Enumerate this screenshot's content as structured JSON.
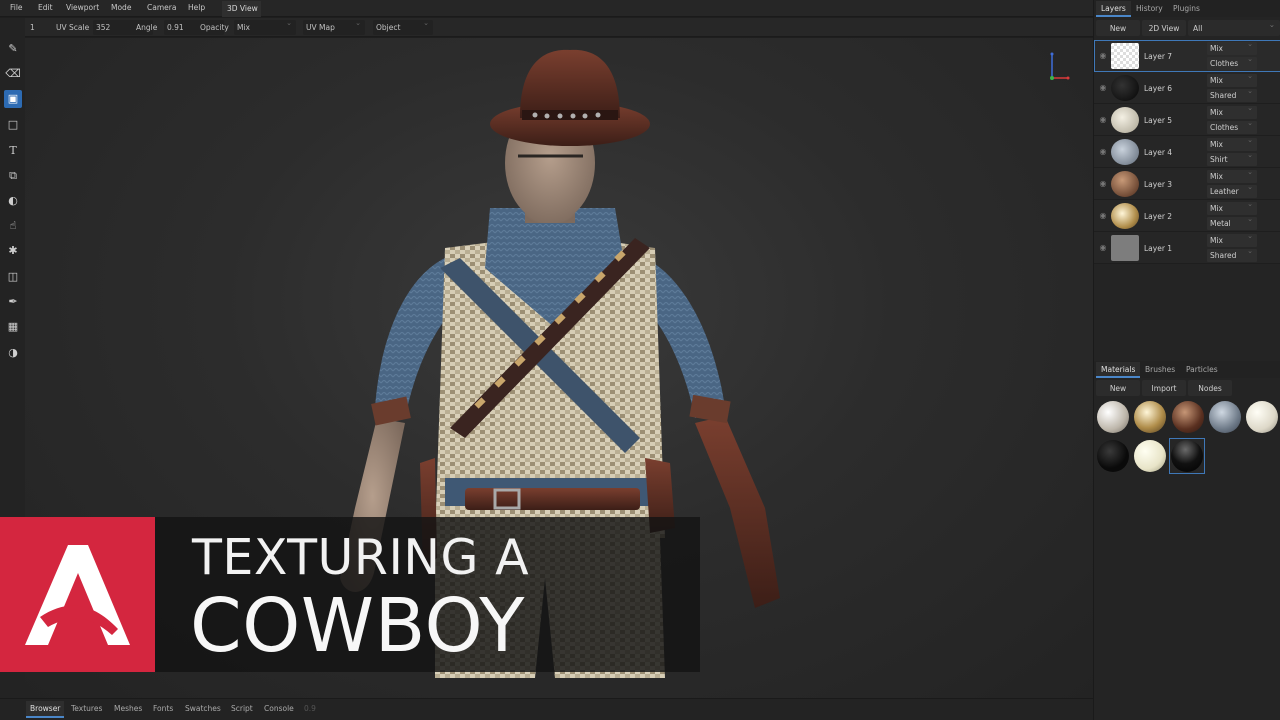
{
  "menu": [
    "File",
    "Edit",
    "Viewport",
    "Mode",
    "Camera",
    "Help"
  ],
  "view_tab": "3D View",
  "toolbar": {
    "size": "1",
    "uv_scale_label": "UV Scale",
    "uv_scale_value": "352",
    "angle_label": "Angle",
    "angle_value": "0.91",
    "opacity_label": "Opacity",
    "blend_mode": "Mix",
    "mapping": "UV Map",
    "target": "Object"
  },
  "tools": [
    "brush-icon",
    "eraser-icon",
    "fill-icon",
    "sticker-icon",
    "text-icon",
    "clone-icon",
    "blur-icon",
    "smudge-icon",
    "particle-icon",
    "mask-icon",
    "color-picker-icon",
    "bake-icon",
    "material-ball-icon"
  ],
  "banner": {
    "line1": "TEXTURING A",
    "line2": "COWBOY"
  },
  "bottom_tabs": [
    "Browser",
    "Textures",
    "Meshes",
    "Fonts",
    "Swatches",
    "Script",
    "Console"
  ],
  "bottom_tabs_active": "Browser",
  "bottom_version": "0.9",
  "right_panel": {
    "top_tabs": [
      "Layers",
      "History",
      "Plugins"
    ],
    "active_top_tab": "Layers",
    "buttons": [
      "New",
      "2D View"
    ],
    "filter": "All",
    "layers": [
      {
        "name": "Layer 7",
        "blend": "Mix",
        "mask": "Clothes",
        "selected": true
      },
      {
        "name": "Layer 6",
        "blend": "Mix",
        "mask": "Shared",
        "selected": false
      },
      {
        "name": "Layer 5",
        "blend": "Mix",
        "mask": "Clothes",
        "selected": false
      },
      {
        "name": "Layer 4",
        "blend": "Mix",
        "mask": "Shirt",
        "selected": false
      },
      {
        "name": "Layer 3",
        "blend": "Mix",
        "mask": "Leather",
        "selected": false
      },
      {
        "name": "Layer 2",
        "blend": "Mix",
        "mask": "Metal",
        "selected": false
      },
      {
        "name": "Layer 1",
        "blend": "Mix",
        "mask": "Shared",
        "selected": false
      }
    ],
    "bottom_tabs": [
      "Materials",
      "Brushes",
      "Particles"
    ],
    "active_bottom_tab": "Materials",
    "material_buttons": [
      "New",
      "Import",
      "Nodes"
    ]
  },
  "colors": {
    "accent": "#2d6bb3",
    "logo_red": "#d4263f"
  }
}
